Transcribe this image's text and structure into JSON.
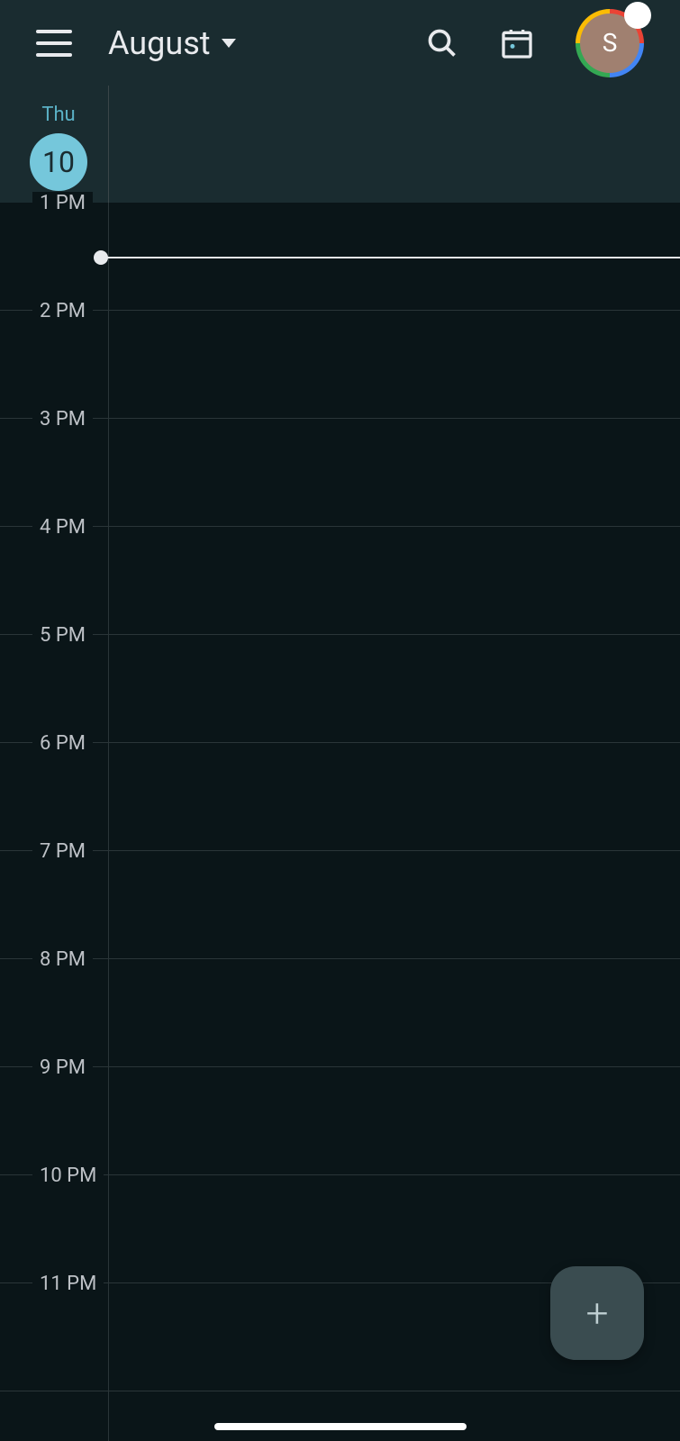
{
  "header": {
    "month_label": "August",
    "avatar_initial": "S"
  },
  "day": {
    "name": "Thu",
    "number": "10"
  },
  "hours": [
    "1 PM",
    "2 PM",
    "3 PM",
    "4 PM",
    "5 PM",
    "6 PM",
    "7 PM",
    "8 PM",
    "9 PM",
    "10 PM",
    "11 PM"
  ],
  "current_time_offset_minutes": 30,
  "icons": {
    "menu": "menu-icon",
    "search": "search-icon",
    "today": "today-calendar-icon",
    "dropdown": "chevron-down-icon",
    "plus": "plus-icon"
  },
  "colors": {
    "accent": "#75c7db",
    "background_dark": "#0a1518",
    "background_header": "#1a2c30",
    "text_primary": "#e8eaed"
  }
}
